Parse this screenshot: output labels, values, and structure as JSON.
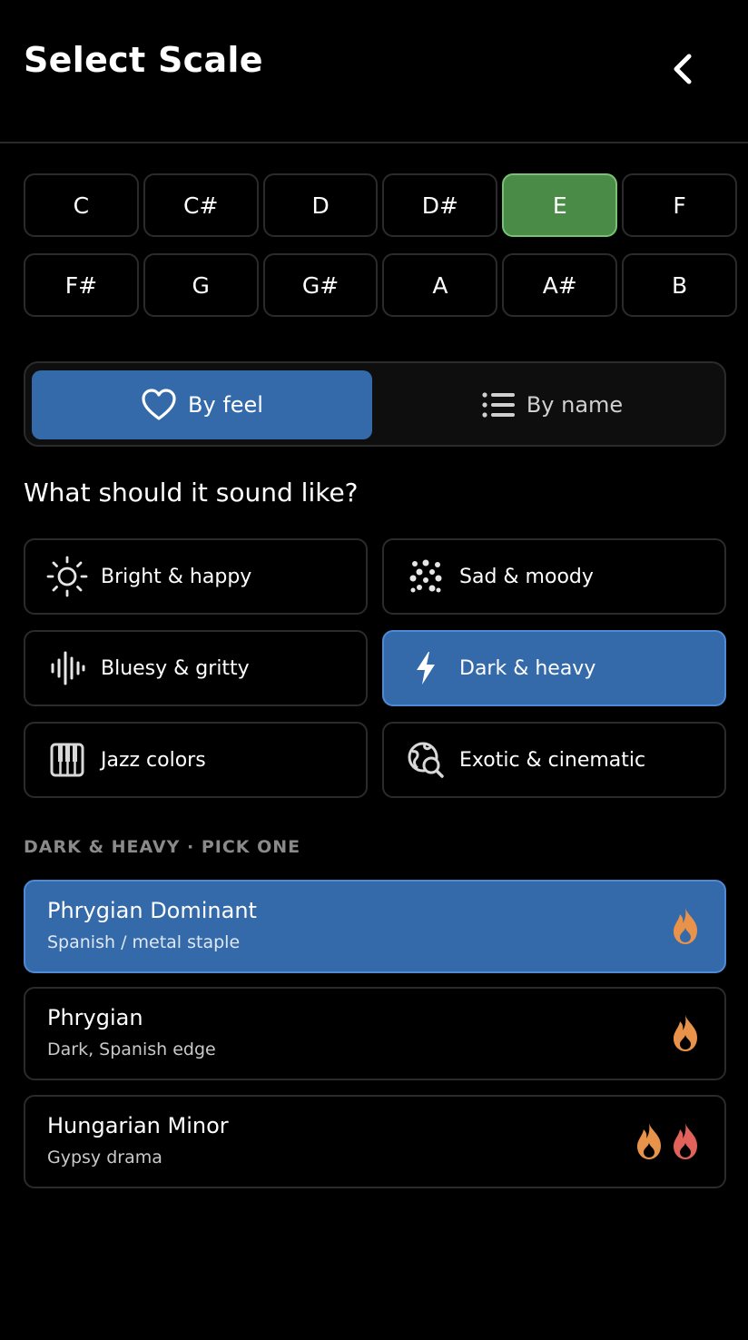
{
  "header": {
    "title": "Select Scale"
  },
  "keys": {
    "row1": [
      "C",
      "C#",
      "D",
      "D#",
      "E",
      "F"
    ],
    "row2": [
      "F#",
      "G",
      "G#",
      "A",
      "A#",
      "B"
    ],
    "selected": "E",
    "selected_color": "#4a8c47"
  },
  "mode_toggle": {
    "by_feel": "By feel",
    "by_name": "By name",
    "active": "By feel"
  },
  "question": "What should it sound like?",
  "feels": [
    {
      "label": "Bright & happy",
      "icon": "sun-icon"
    },
    {
      "label": "Sad & moody",
      "icon": "dots-icon"
    },
    {
      "label": "Bluesy & gritty",
      "icon": "waveform-icon"
    },
    {
      "label": "Dark & heavy",
      "icon": "bolt-icon"
    },
    {
      "label": "Jazz colors",
      "icon": "piano-icon"
    },
    {
      "label": "Exotic & cinematic",
      "icon": "globe-search-icon"
    }
  ],
  "active_feel": "Dark & heavy",
  "section_label": "DARK & HEAVY · PICK ONE",
  "scales": [
    {
      "name": "Phrygian Dominant",
      "desc": "Spanish / metal staple",
      "flames": 1
    },
    {
      "name": "Phrygian",
      "desc": "Dark, Spanish edge",
      "flames": 1
    },
    {
      "name": "Hungarian Minor",
      "desc": "Gypsy drama",
      "flames": 2
    }
  ],
  "selected_scale": "Phrygian Dominant",
  "colors": {
    "accent": "#346aa9",
    "flame_orange": "#e8924a",
    "flame_red": "#e0625a"
  }
}
